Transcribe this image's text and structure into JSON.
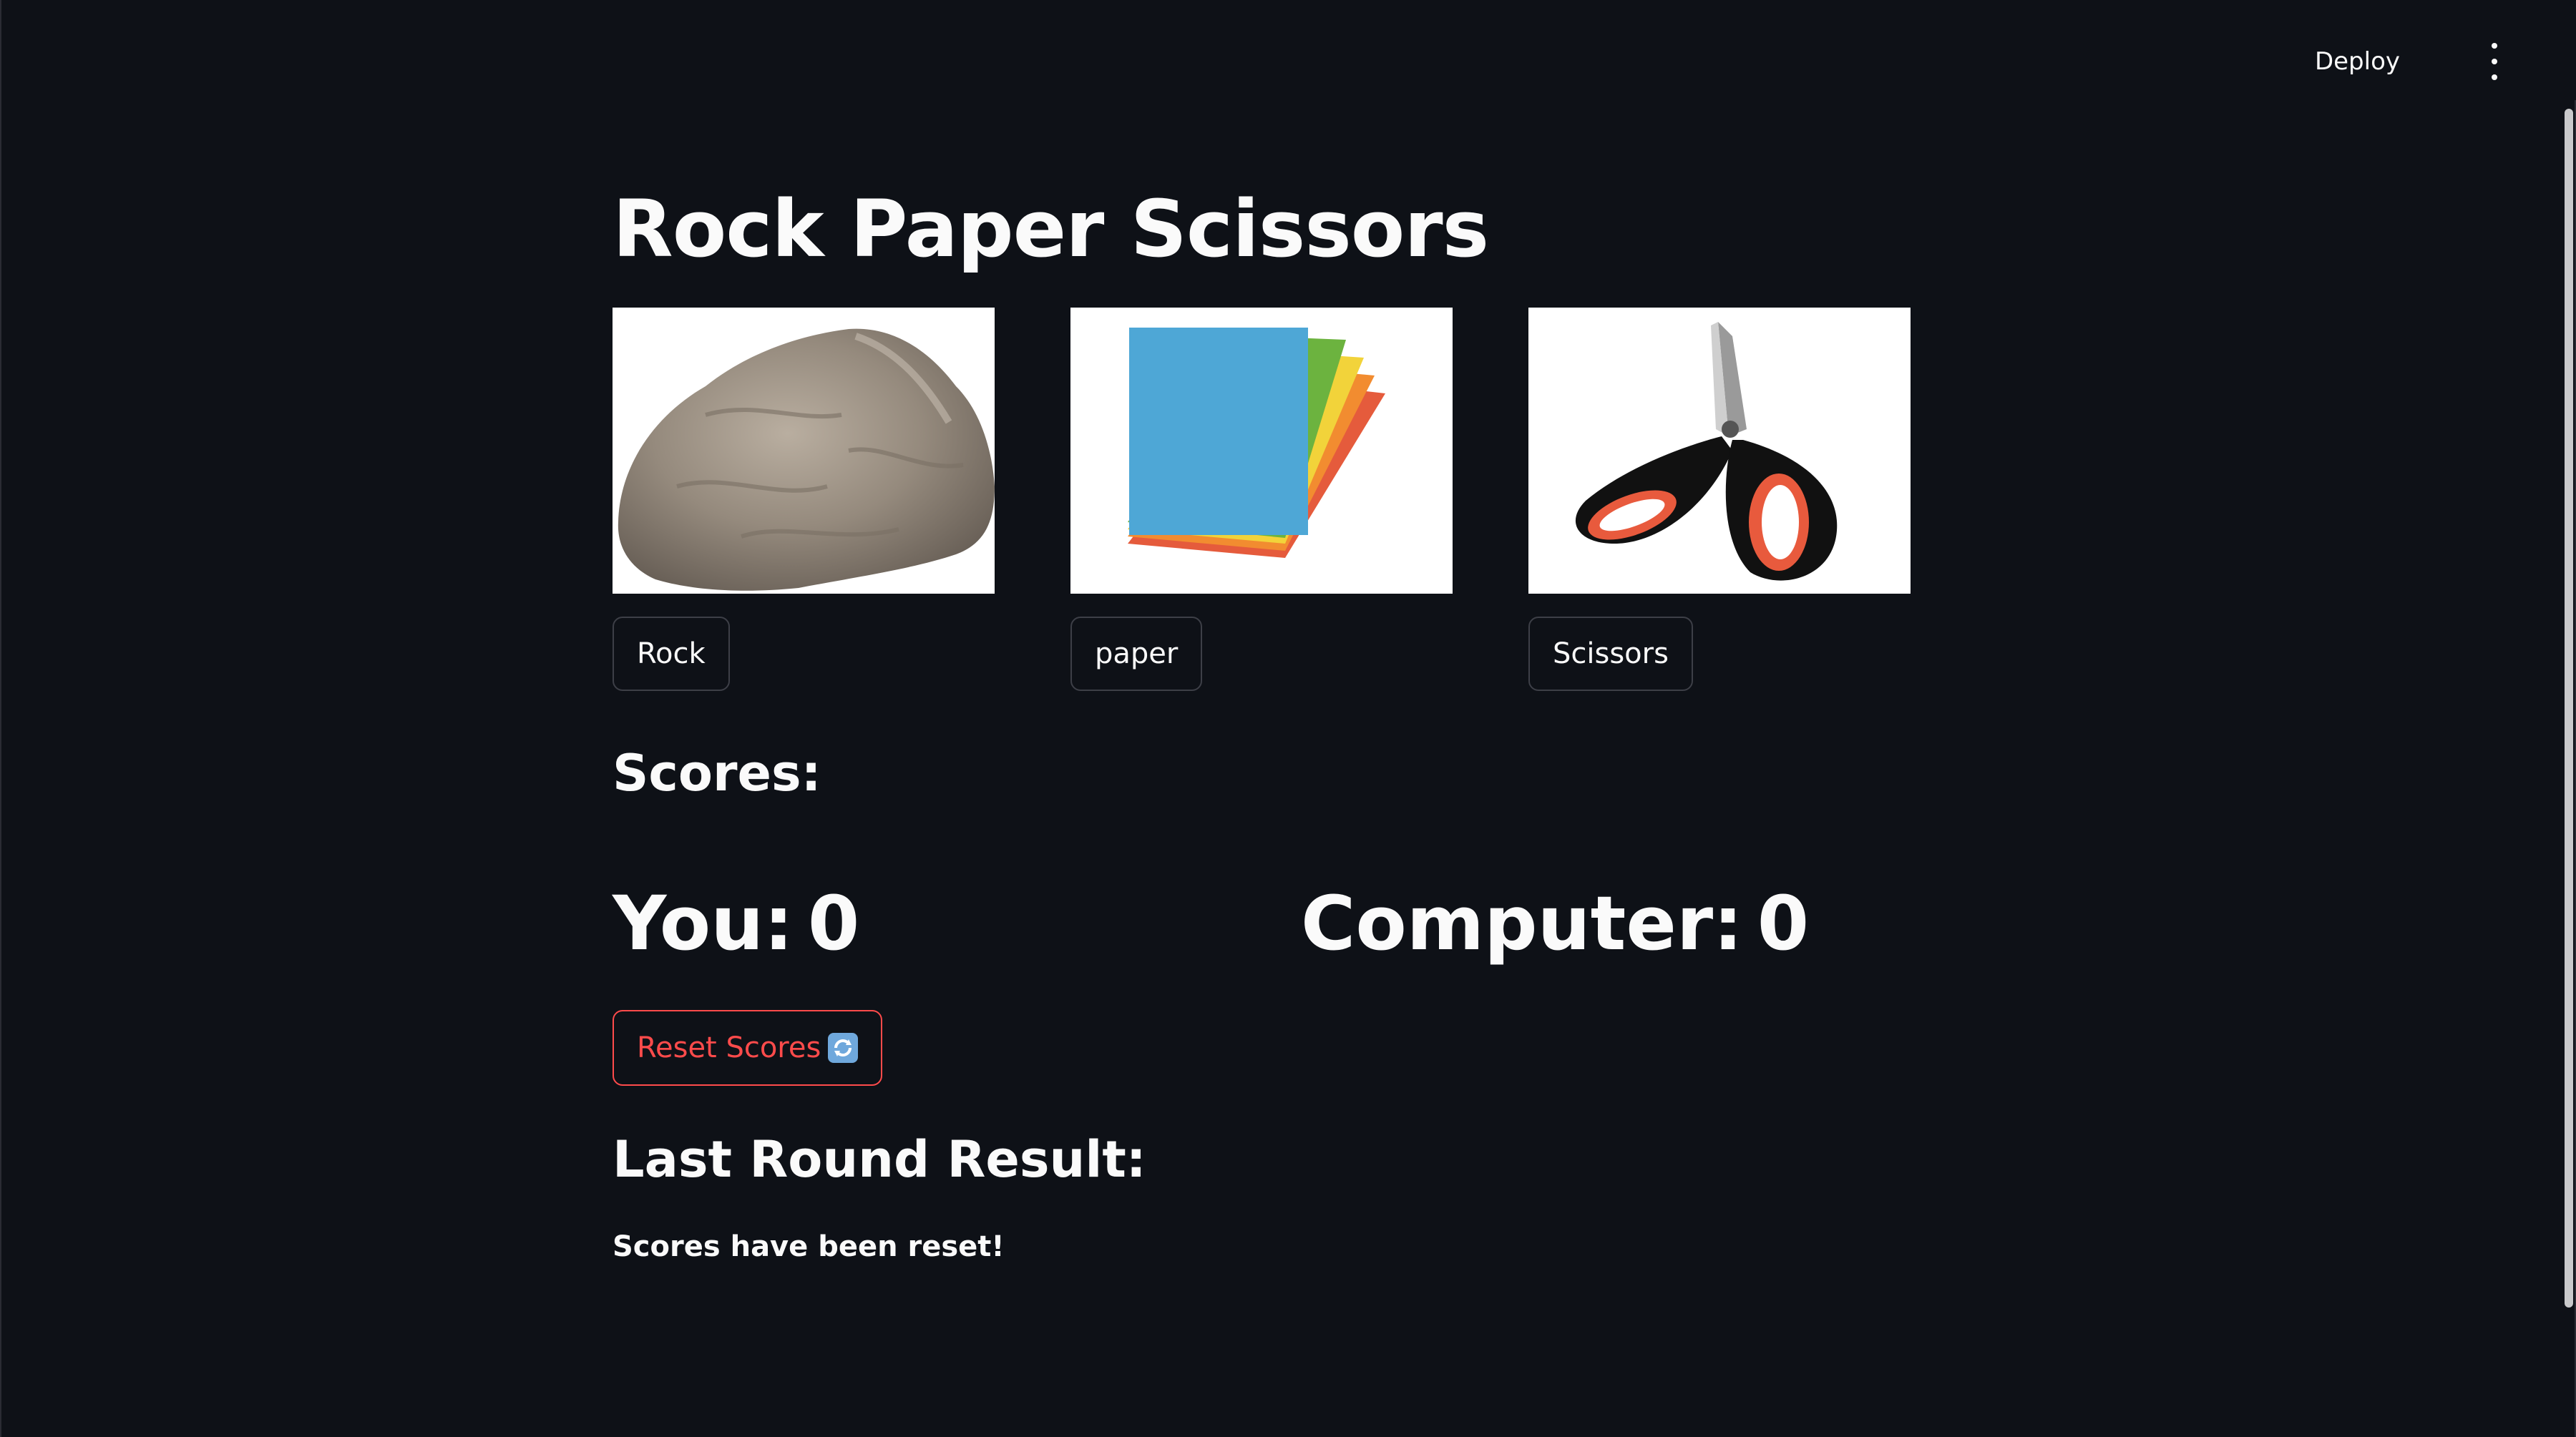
{
  "header": {
    "deploy_label": "Deploy",
    "menu_icon": "vertical-dots-icon"
  },
  "main": {
    "title": "Rock Paper Scissors",
    "choices": [
      {
        "label": "Rock",
        "image": "rock-image"
      },
      {
        "label": "paper",
        "image": "paper-image"
      },
      {
        "label": "Scissors",
        "image": "scissors-image"
      }
    ],
    "scores_heading": "Scores:",
    "you_label": "You:",
    "you_score": "0",
    "computer_label": "Computer:",
    "computer_score": "0",
    "reset_label": "Reset Scores",
    "reset_icon": "refresh-icon",
    "result_heading": "Last Round Result:",
    "result_text": "Scores have been reset!"
  },
  "colors": {
    "background": "#0e1117",
    "text": "#fafafa",
    "accent": "#ff4b4b",
    "button_border": "#3d3f47"
  }
}
